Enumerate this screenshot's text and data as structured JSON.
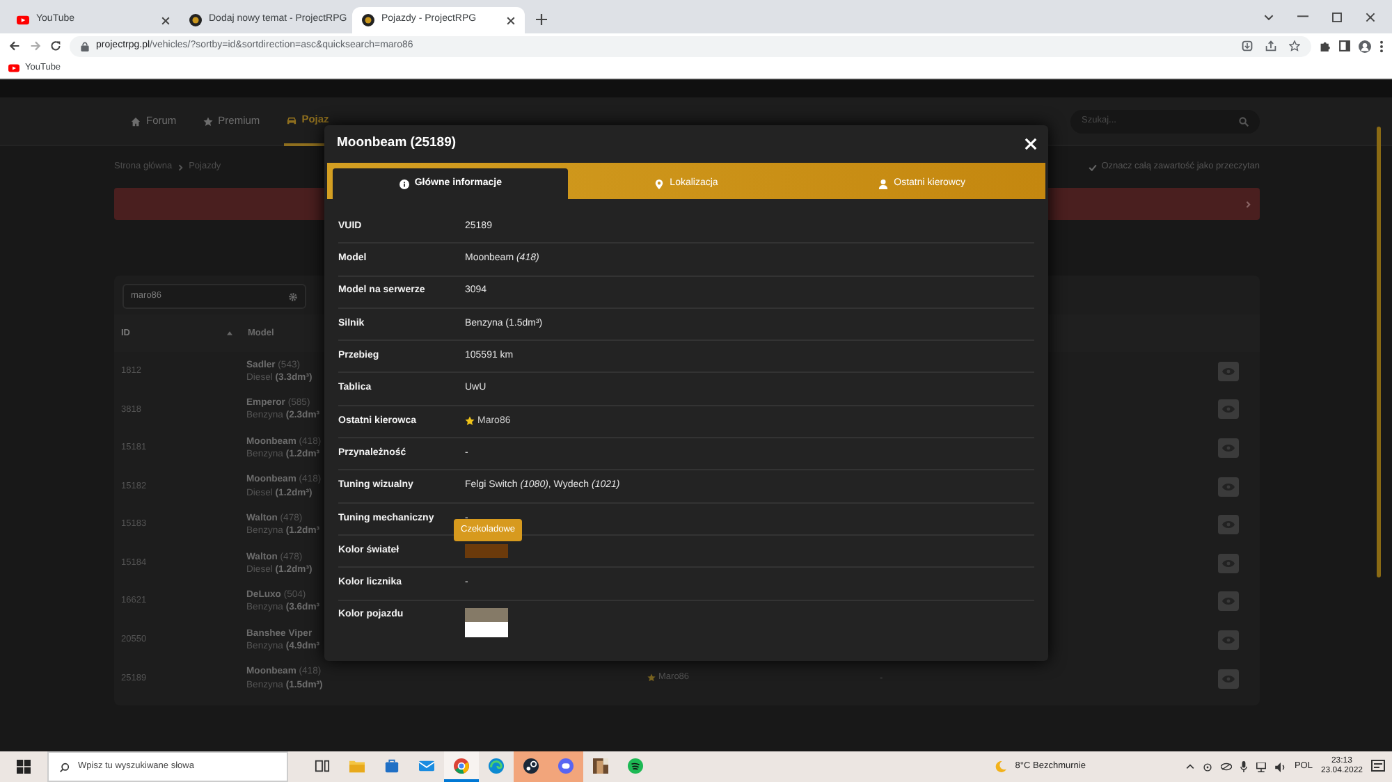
{
  "browser": {
    "tabs": [
      {
        "title": "YouTube",
        "kind": "youtube",
        "selected": false
      },
      {
        "title": "Dodaj nowy temat - ProjectRPG",
        "kind": "site",
        "selected": false
      },
      {
        "title": "Pojazdy - ProjectRPG",
        "kind": "site",
        "selected": true
      }
    ],
    "url": {
      "domain": "projectrpg.pl",
      "path": "/vehicles/?sortby=id&sortdirection=asc&quicksearch=maro86"
    },
    "bookmarks": [
      {
        "title": "YouTube",
        "kind": "youtube"
      }
    ]
  },
  "site": {
    "nav": [
      {
        "label": "Forum",
        "kind": "home",
        "selected": false
      },
      {
        "label": "Premium",
        "kind": "star",
        "selected": false
      },
      {
        "label": "Pojaz",
        "kind": "car",
        "selected": true
      }
    ],
    "search": {
      "placeholder": "Szukaj..."
    },
    "breadcrumb": [
      "Strona główna",
      "Pojazdy"
    ],
    "mark_read": "Oznacz całą zawartość jako przeczytan"
  },
  "table": {
    "quicksearch": {
      "value": "maro86"
    },
    "columns": [
      {
        "label": "ID",
        "sorted": true
      },
      {
        "label": "Model",
        "sorted": false
      }
    ],
    "rows": [
      {
        "id": "1812",
        "name": "Sadler",
        "count": "(543)",
        "fuel": "Diesel",
        "capacity": "(3.3dm³)"
      },
      {
        "id": "3818",
        "name": "Emperor",
        "count": "(585)",
        "fuel": "Benzyna",
        "capacity": "(2.3dm³"
      },
      {
        "id": "15181",
        "name": "Moonbeam",
        "count": "(418)",
        "fuel": "Benzyna",
        "capacity": "(1.2dm³"
      },
      {
        "id": "15182",
        "name": "Moonbeam",
        "count": "(418)",
        "fuel": "Diesel",
        "capacity": "(1.2dm³)"
      },
      {
        "id": "15183",
        "name": "Walton",
        "count": "(478)",
        "fuel": "Benzyna",
        "capacity": "(1.2dm³"
      },
      {
        "id": "15184",
        "name": "Walton",
        "count": "(478)",
        "fuel": "Diesel",
        "capacity": "(1.2dm³)"
      },
      {
        "id": "16621",
        "name": "DeLuxo",
        "count": "(504)",
        "fuel": "Benzyna",
        "capacity": "(3.6dm³"
      },
      {
        "id": "20550",
        "name": "Banshee Viper",
        "fuel": "Benzyna",
        "capacity": "(4.9dm³"
      },
      {
        "id": "25189",
        "name": "Moonbeam",
        "count": "(418)",
        "fuel": "Benzyna",
        "capacity": "(1.5dm³)",
        "driver": "Maro86",
        "column_4": "-"
      }
    ]
  },
  "modal": {
    "title": "Moonbeam (25189)",
    "tabs": [
      {
        "label": "Główne informacje",
        "kind": "info",
        "selected": true
      },
      {
        "label": "Lokalizacja",
        "kind": "pin",
        "selected": false
      },
      {
        "label": "Ostatni kierowcy",
        "kind": "person",
        "selected": false
      }
    ],
    "fields": [
      {
        "label": "VUID",
        "kind": "text",
        "value": "25189"
      },
      {
        "label": "Model",
        "kind": "text",
        "value": "Moonbeam *(418)*"
      },
      {
        "label": "Model na serwerze",
        "kind": "text",
        "value": "3094"
      },
      {
        "label": "Silnik",
        "kind": "text",
        "value": "Benzyna (1.5dm³)"
      },
      {
        "label": "Przebieg",
        "kind": "text",
        "value": "105591 km"
      },
      {
        "label": "Tablica",
        "kind": "text",
        "value": "UwU"
      },
      {
        "label": "Ostatni kierowca",
        "kind": "driver",
        "value": "Maro86"
      },
      {
        "label": "Przynależność",
        "kind": "text",
        "value": "-"
      },
      {
        "label": "Tuning wizualny",
        "kind": "text",
        "value": "Felgi Switch *(1080)*, Wydech *(1021)*"
      },
      {
        "label": "Tuning mechaniczny",
        "kind": "text",
        "value": "-"
      },
      {
        "label": "Kolor świateł",
        "kind": "swatch",
        "color": "#6b3a0b",
        "tooltip": "Czekoladowe"
      },
      {
        "label": "Kolor licznika",
        "kind": "text",
        "value": "-"
      },
      {
        "label": "Kolor pojazdu",
        "kind": "swatches",
        "colors": [
          {
            "color": "#857a67"
          },
          {
            "color": "#ffffff"
          }
        ]
      }
    ]
  },
  "taskbar": {
    "search": {
      "placeholder": "Wpisz tu wyszukiwane słowa"
    },
    "apps": [
      {
        "kind": "taskview",
        "active": false,
        "flashing": false
      },
      {
        "kind": "folder",
        "active": false,
        "flashing": false
      },
      {
        "kind": "store",
        "active": false,
        "flashing": false
      },
      {
        "kind": "mail",
        "active": false,
        "flashing": false
      },
      {
        "kind": "browser",
        "active": true,
        "flashing": false
      },
      {
        "kind": "edge",
        "active": false,
        "flashing": false
      },
      {
        "kind": "steam",
        "active": false,
        "flashing": true
      },
      {
        "kind": "chat",
        "active": false,
        "flashing": true
      },
      {
        "kind": "game",
        "active": false,
        "flashing": false
      },
      {
        "kind": "music",
        "active": false,
        "flashing": false
      }
    ],
    "weather": "8°C Bezchmurnie",
    "language": "POL",
    "time": "23:13",
    "date": "23.04.2022"
  }
}
